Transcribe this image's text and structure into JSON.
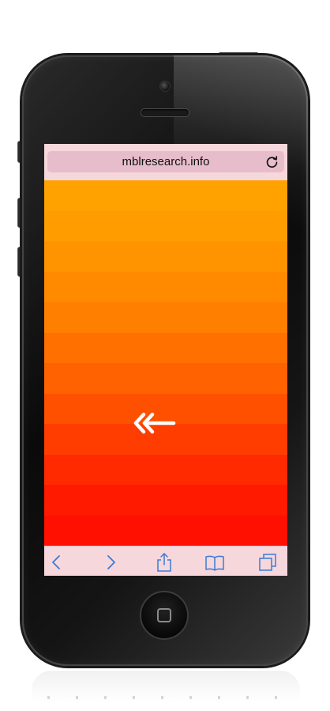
{
  "browser": {
    "url": "mblresearch.info",
    "reload_icon": "reload-icon"
  },
  "content": {
    "gradient_bands": [
      "#ffa200",
      "#ff9d00",
      "#ff9400",
      "#ff8a00",
      "#ff7f00",
      "#ff7000",
      "#ff6200",
      "#ff5000",
      "#ff3d00",
      "#ff2a00",
      "#ff1a00",
      "#ff1000"
    ],
    "gesture_icon": "double-chevron-left-arrow-icon",
    "gesture_icon_color": "#ffffff"
  },
  "toolbar": {
    "items": [
      {
        "name": "back",
        "icon": "chevron-left-icon"
      },
      {
        "name": "forward",
        "icon": "chevron-right-icon"
      },
      {
        "name": "share",
        "icon": "share-icon"
      },
      {
        "name": "bookmarks",
        "icon": "book-icon"
      },
      {
        "name": "tabs",
        "icon": "tabs-icon"
      }
    ],
    "icon_color": "#3a7bd5"
  },
  "device": {
    "body_color": "#0d0d0d",
    "browser_chrome_color": "#f6d7dc"
  }
}
